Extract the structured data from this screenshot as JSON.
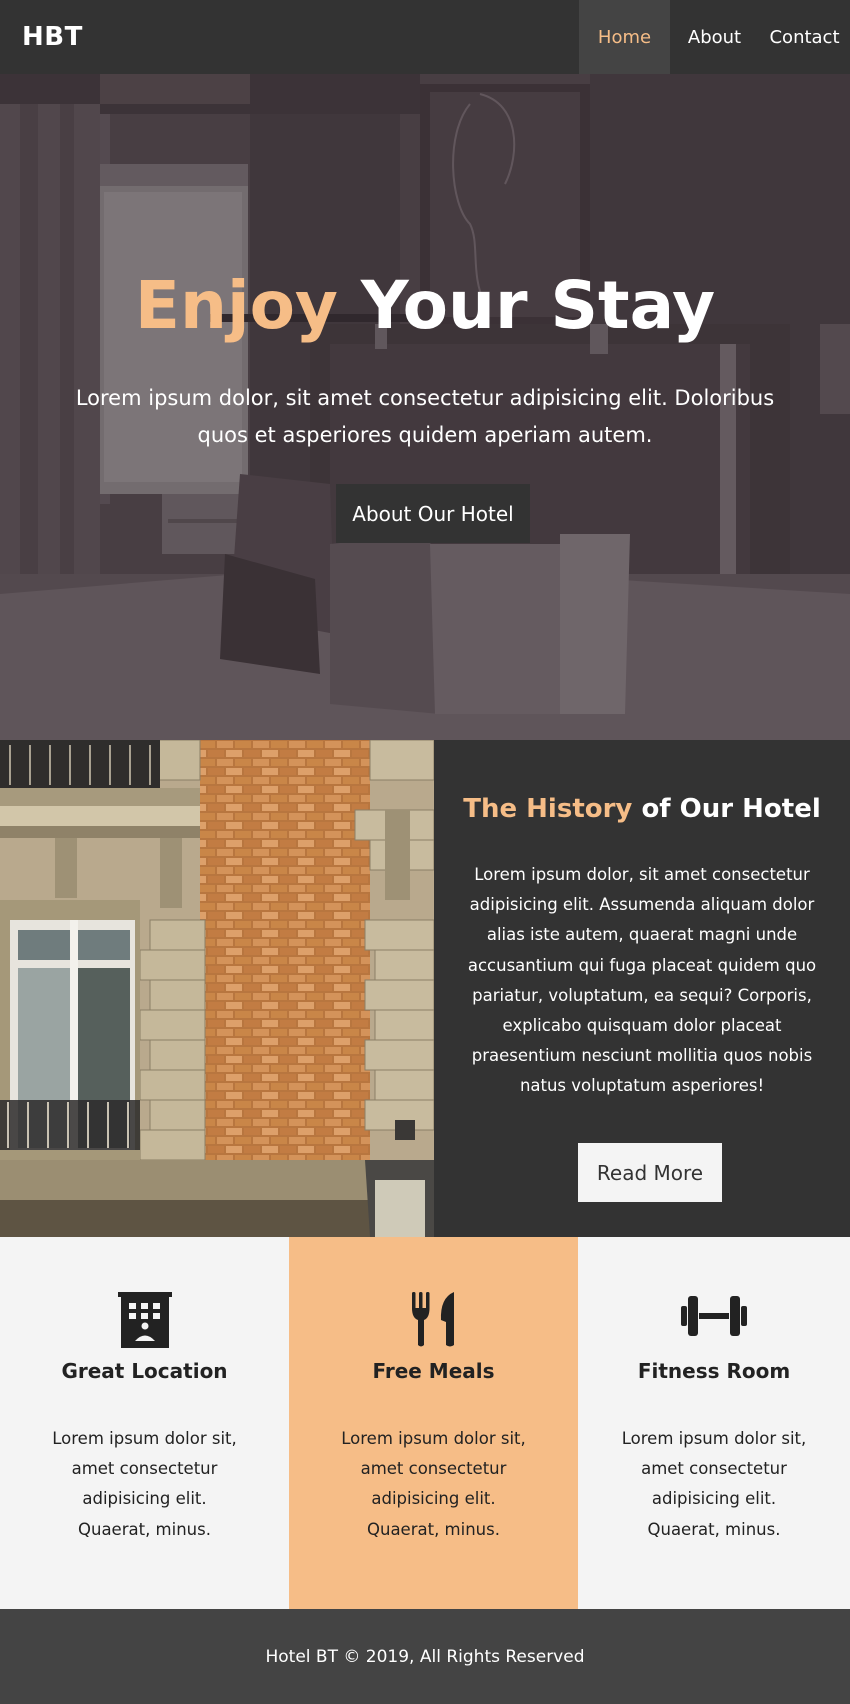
{
  "nav": {
    "brand": "HBT",
    "links": [
      {
        "label": "Home",
        "active": true
      },
      {
        "label": "About",
        "active": false
      },
      {
        "label": "Contact",
        "active": false
      }
    ]
  },
  "hero": {
    "title_accent": "Enjoy",
    "title_rest": "Your Stay",
    "text": "Lorem ipsum dolor, sit amet consectetur adipisicing elit. Doloribus quos et asperiores quidem aperiam autem.",
    "button": "About Our Hotel"
  },
  "history": {
    "title_accent": "The History",
    "title_rest": "of Our Hotel",
    "text": "Lorem ipsum dolor, sit amet consectetur adipisicing elit. Assumenda aliquam dolor alias iste autem, quaerat magni unde accusantium qui fuga placeat quidem quo pariatur, voluptatum, ea sequi? Corporis, explicabo quisquam dolor placeat praesentium nesciunt mollitia quos nobis natus voluptatum asperiores!",
    "button": "Read More"
  },
  "features": [
    {
      "icon": "building-icon",
      "title": "Great Location",
      "text": "Lorem ipsum dolor sit, amet consectetur adipisicing elit. Quaerat, minus."
    },
    {
      "icon": "utensils-icon",
      "title": "Free Meals",
      "text": "Lorem ipsum dolor sit, amet consectetur adipisicing elit. Quaerat, minus."
    },
    {
      "icon": "dumbbell-icon",
      "title": "Fitness Room",
      "text": "Lorem ipsum dolor sit, amet consectetur adipisicing elit. Quaerat, minus."
    }
  ],
  "footer": {
    "text": "Hotel BT © 2019, All Rights Reserved"
  },
  "colors": {
    "accent": "#f6bd87",
    "dark": "#333333",
    "light": "#f4f4f4",
    "footer": "#444444"
  }
}
